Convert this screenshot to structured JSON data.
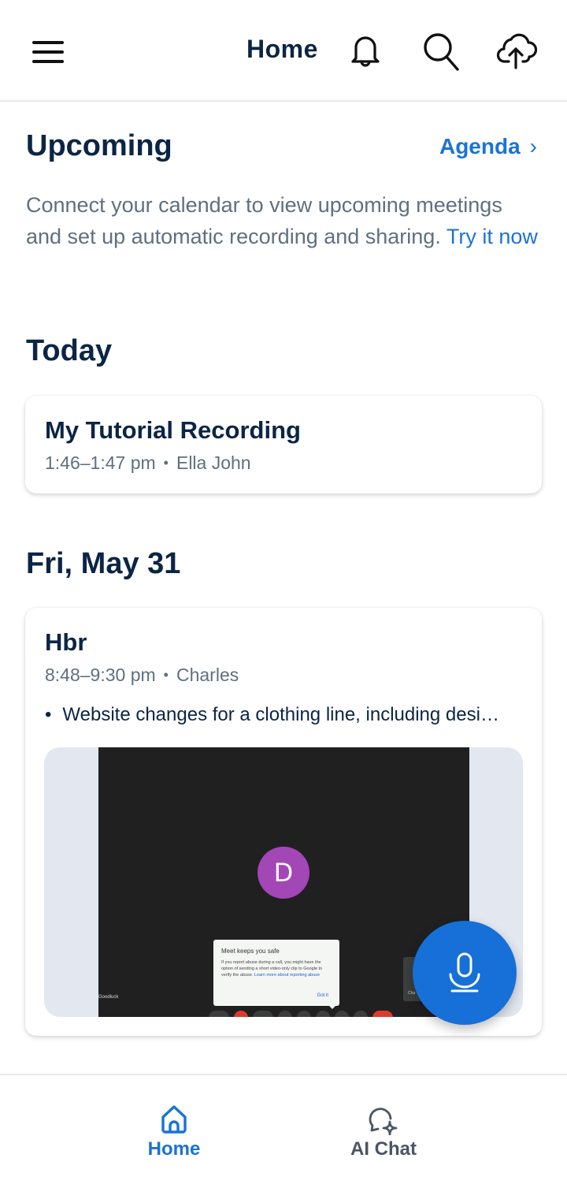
{
  "header": {
    "title": "Home",
    "icons": [
      "hamburger-menu-icon",
      "bell-icon",
      "search-icon",
      "cloud-upload-icon"
    ]
  },
  "upcoming": {
    "title": "Upcoming",
    "agenda_link": "Agenda",
    "agenda_chevron": "›",
    "description": "Connect your calendar to view upcoming meetings and set up automatic recording and sharing.",
    "try_link": "Try it now"
  },
  "today": {
    "title": "Today",
    "meetings": [
      {
        "title": "My Tutorial Recording",
        "time": "1:46–1:47 pm",
        "separator": "•",
        "owner": "Ella John"
      }
    ]
  },
  "fri_may_31": {
    "title": "Fri, May 31",
    "meetings": [
      {
        "title": "Hbr",
        "time": "8:48–9:30 pm",
        "separator": "•",
        "owner": "Charles",
        "summary_bullet": "•",
        "summary": "Website changes for a clothing line, including desi…",
        "thumbnail": {
          "avatar_letter": "D",
          "avatar_color": "#a346b6",
          "popup_title": "Meet keeps you safe",
          "popup_body": "If you report abuse during a call, you might have the option of sending a short video-only clip to Google to verify the abuse.",
          "popup_link": "Learn more about reporting abuse",
          "popup_button": "Got it",
          "name_tag": "Goodluck",
          "side_tile_label": "Cha"
        }
      }
    ]
  },
  "fab": {
    "icon": "microphone-icon",
    "color": "#1670d8"
  },
  "bottom_nav": {
    "items": [
      {
        "label": "Home",
        "icon": "home-icon",
        "active": true
      },
      {
        "label": "AI Chat",
        "icon": "ai-chat-icon",
        "active": false
      }
    ],
    "active_color": "#1a73d6",
    "inactive_color": "#4a5565"
  }
}
